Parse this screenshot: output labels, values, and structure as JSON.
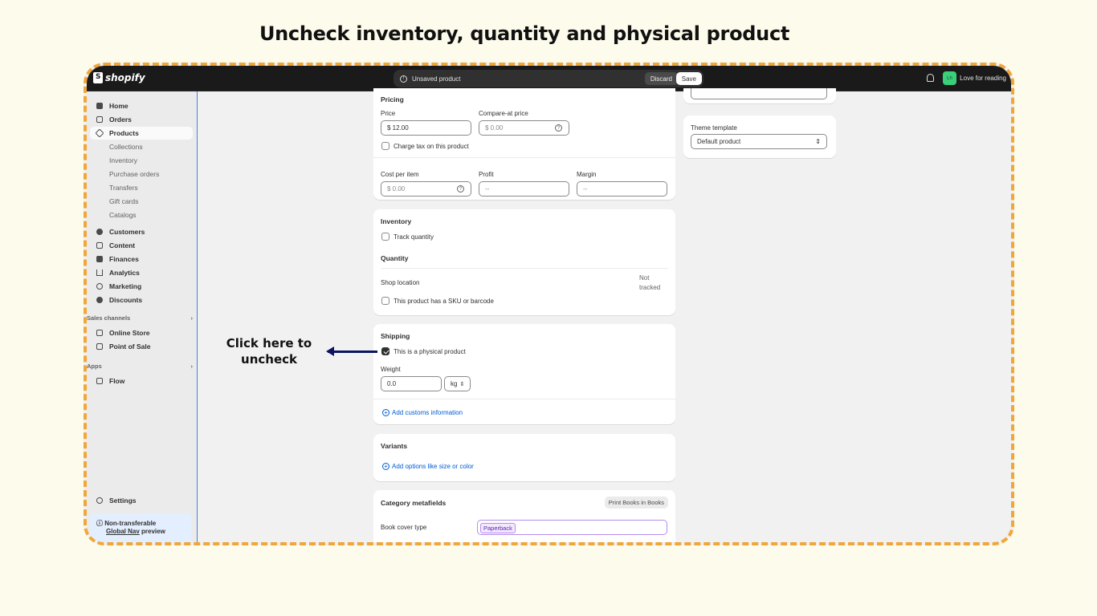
{
  "headline": "Uncheck inventory, quantity and physical product",
  "annotation": {
    "line1": "Click here to",
    "line2": "uncheck"
  },
  "topbar": {
    "logo": "shopify",
    "unsaved_label": "Unsaved product",
    "discard_label": "Discard",
    "save_label": "Save",
    "store_initials": "Lh",
    "store_name": "Love for reading"
  },
  "sidebar": {
    "items": [
      {
        "label": "Home",
        "icon": "home-icon"
      },
      {
        "label": "Orders",
        "icon": "orders-icon"
      },
      {
        "label": "Products",
        "icon": "tag-icon"
      },
      {
        "label": "Collections"
      },
      {
        "label": "Inventory"
      },
      {
        "label": "Purchase orders"
      },
      {
        "label": "Transfers"
      },
      {
        "label": "Gift cards"
      },
      {
        "label": "Catalogs"
      },
      {
        "label": "Customers",
        "icon": "person-icon"
      },
      {
        "label": "Content",
        "icon": "content-icon"
      },
      {
        "label": "Finances",
        "icon": "bank-icon"
      },
      {
        "label": "Analytics",
        "icon": "bar-chart-icon"
      },
      {
        "label": "Marketing",
        "icon": "target-icon"
      },
      {
        "label": "Discounts",
        "icon": "discount-icon"
      }
    ],
    "sales_channels_label": "Sales channels",
    "channels": [
      {
        "label": "Online Store",
        "icon": "store-icon"
      },
      {
        "label": "Point of Sale",
        "icon": "pos-icon"
      }
    ],
    "apps_label": "Apps",
    "apps": [
      {
        "label": "Flow",
        "icon": "flow-icon"
      }
    ],
    "settings_label": "Settings",
    "nontransferable_line1": "Non-transferable",
    "nontransferable_link": "Global Nav",
    "nontransferable_suffix": " preview"
  },
  "pricing": {
    "title": "Pricing",
    "price_label": "Price",
    "price_value": "$  12.00",
    "compare_label": "Compare-at price",
    "compare_value": "$  0.00",
    "charge_tax_label": "Charge tax on this product",
    "cost_label": "Cost per item",
    "cost_value": "$  0.00",
    "profit_label": "Profit",
    "profit_value": "--",
    "margin_label": "Margin",
    "margin_value": "--"
  },
  "inventory": {
    "title": "Inventory",
    "track_label": "Track quantity",
    "quantity_title": "Quantity",
    "location_label": "Shop location",
    "not_tracked_1": "Not",
    "not_tracked_2": "tracked",
    "sku_label": "This product has a SKU or barcode"
  },
  "shipping": {
    "title": "Shipping",
    "physical_label": "This is a physical product",
    "physical_checked": true,
    "weight_label": "Weight",
    "weight_value": "0.0",
    "unit_value": "kg",
    "customs_link": "Add customs information"
  },
  "variants": {
    "title": "Variants",
    "add_options_link": "Add options like size or color"
  },
  "metafields": {
    "title": "Category metafields",
    "category_badge": "Print Books in Books",
    "cover_label": "Book cover type",
    "cover_tag": "Paperback"
  },
  "right": {
    "theme_label": "Theme template",
    "theme_value": "Default product"
  }
}
